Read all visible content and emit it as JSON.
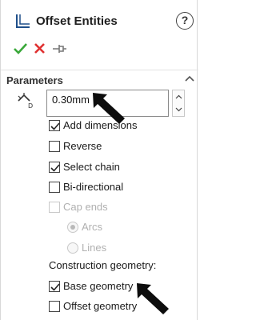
{
  "header": {
    "title": "Offset Entities",
    "help_glyph": "?"
  },
  "actions": {
    "ok": "check-icon",
    "cancel": "close-icon",
    "pin": "pushpin-icon",
    "ok_color": "#3aa83a",
    "cancel_color": "#e03030"
  },
  "parameters": {
    "section_title": "Parameters",
    "offset_value": "0.30mm",
    "options": [
      {
        "label": "Add dimensions",
        "checked": true,
        "enabled": true
      },
      {
        "label": "Reverse",
        "checked": false,
        "enabled": true
      },
      {
        "label": "Select chain",
        "checked": true,
        "enabled": true
      },
      {
        "label": "Bi-directional",
        "checked": false,
        "enabled": true
      },
      {
        "label": "Cap ends",
        "checked": false,
        "enabled": false
      }
    ],
    "cap_types": [
      {
        "label": "Arcs",
        "selected": true,
        "enabled": false
      },
      {
        "label": "Lines",
        "selected": false,
        "enabled": false
      }
    ],
    "construction_label": "Construction geometry:",
    "construction_options": [
      {
        "label": "Base geometry",
        "checked": true
      },
      {
        "label": "Offset geometry",
        "checked": false
      }
    ]
  }
}
